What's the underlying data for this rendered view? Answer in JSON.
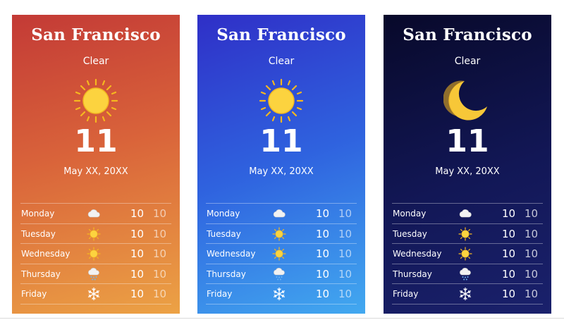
{
  "cards": [
    {
      "theme": "sunset",
      "city": "San Francisco",
      "condition": "Clear",
      "main_icon": "sun-icon",
      "temperature": "11",
      "date": "May XX, 20XX",
      "forecast": [
        {
          "day": "Monday",
          "icon": "cloud-icon",
          "high": "10",
          "low": "10"
        },
        {
          "day": "Tuesday",
          "icon": "sun-icon",
          "high": "10",
          "low": "10"
        },
        {
          "day": "Wednesday",
          "icon": "sun-icon",
          "high": "10",
          "low": "10"
        },
        {
          "day": "Thursday",
          "icon": "rain-cloud-icon",
          "high": "10",
          "low": "10"
        },
        {
          "day": "Friday",
          "icon": "snowflake-icon",
          "high": "10",
          "low": "10"
        }
      ]
    },
    {
      "theme": "day",
      "city": "San Francisco",
      "condition": "Clear",
      "main_icon": "sun-icon",
      "temperature": "11",
      "date": "May XX, 20XX",
      "forecast": [
        {
          "day": "Monday",
          "icon": "cloud-icon",
          "high": "10",
          "low": "10"
        },
        {
          "day": "Tuesday",
          "icon": "sun-icon",
          "high": "10",
          "low": "10"
        },
        {
          "day": "Wednesday",
          "icon": "sun-icon",
          "high": "10",
          "low": "10"
        },
        {
          "day": "Thursday",
          "icon": "rain-cloud-icon",
          "high": "10",
          "low": "10"
        },
        {
          "day": "Friday",
          "icon": "snowflake-icon",
          "high": "10",
          "low": "10"
        }
      ]
    },
    {
      "theme": "night",
      "city": "San Francisco",
      "condition": "Clear",
      "main_icon": "moon-icon",
      "temperature": "11",
      "date": "May XX, 20XX",
      "forecast": [
        {
          "day": "Monday",
          "icon": "cloud-icon",
          "high": "10",
          "low": "10"
        },
        {
          "day": "Tuesday",
          "icon": "sun-icon",
          "high": "10",
          "low": "10"
        },
        {
          "day": "Wednesday",
          "icon": "sun-icon",
          "high": "10",
          "low": "10"
        },
        {
          "day": "Thursday",
          "icon": "rain-cloud-icon",
          "high": "10",
          "low": "10"
        },
        {
          "day": "Friday",
          "icon": "snowflake-icon",
          "high": "10",
          "low": "10"
        }
      ]
    }
  ],
  "colors": {
    "sun": "#fcd33f",
    "sun_rays": "#f6b81f",
    "moon": "#f7c738",
    "cloud": "#eeeeee",
    "rain": "#6fb6f2"
  }
}
